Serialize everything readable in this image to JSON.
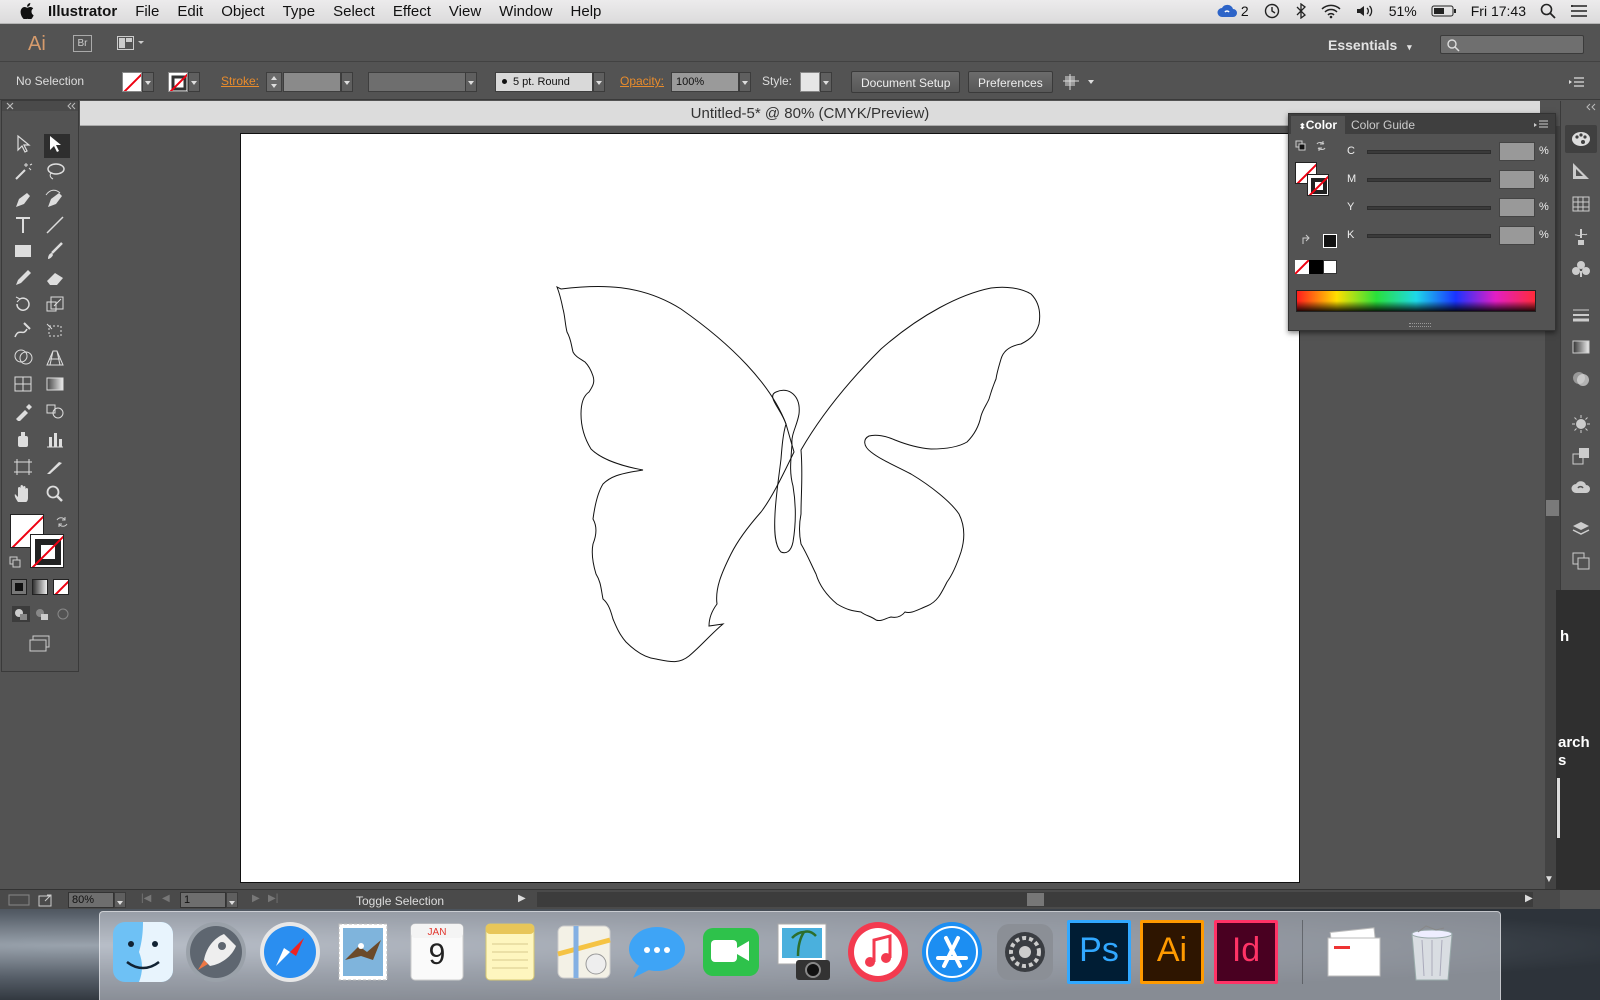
{
  "menubar": {
    "app": "Illustrator",
    "items": [
      "File",
      "Edit",
      "Object",
      "Type",
      "Select",
      "Effect",
      "View",
      "Window",
      "Help"
    ],
    "cc_count": "2",
    "battery": "51%",
    "clock": "Fri 17:43"
  },
  "appbar": {
    "ai_label": "Ai",
    "br_label": "Br",
    "workspace": "Essentials"
  },
  "control": {
    "selection": "No Selection",
    "stroke_label": "Stroke:",
    "brush": "5 pt. Round",
    "opacity_label": "Opacity:",
    "opacity_value": "100%",
    "style_label": "Style:",
    "document_setup": "Document Setup",
    "preferences": "Preferences"
  },
  "document": {
    "title": "Untitled-5* @ 80% (CMYK/Preview)"
  },
  "status": {
    "zoom": "80%",
    "page": "1",
    "message": "Toggle Selection"
  },
  "color_panel": {
    "tabs": [
      "Color",
      "Color Guide"
    ],
    "channels": [
      "C",
      "M",
      "Y",
      "K"
    ],
    "pct": "%"
  },
  "behind_text": {
    "line1": "h",
    "line2": "arch",
    "line3": "s"
  },
  "dock": {
    "calendar_month": "JAN",
    "calendar_day": "9",
    "ps": "Ps",
    "ai": "Ai",
    "id": "Id"
  },
  "colors": {
    "accent_orange": "#e98c2c",
    "ai_brand": "#ff9a00",
    "ps_brand": "#31a8ff",
    "id_brand": "#ff3366"
  }
}
